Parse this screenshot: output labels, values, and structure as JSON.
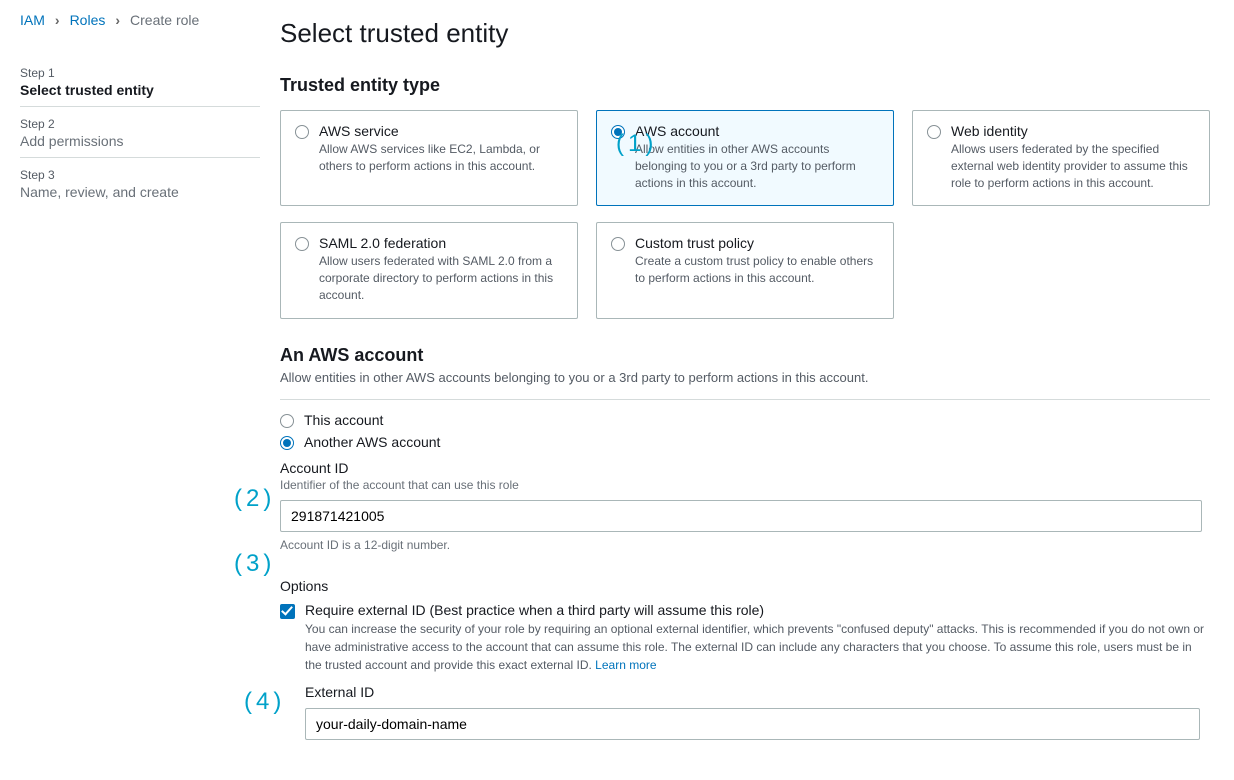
{
  "breadcrumb": {
    "iam": "IAM",
    "roles": "Roles",
    "current": "Create role"
  },
  "steps": [
    {
      "label": "Step 1",
      "title": "Select trusted entity"
    },
    {
      "label": "Step 2",
      "title": "Add permissions"
    },
    {
      "label": "Step 3",
      "title": "Name, review, and create"
    }
  ],
  "page_title": "Select trusted entity",
  "entity_section_title": "Trusted entity type",
  "entities": [
    {
      "title": "AWS service",
      "desc": "Allow AWS services like EC2, Lambda, or others to perform actions in this account."
    },
    {
      "title": "AWS account",
      "desc": "Allow entities in other AWS accounts belonging to you or a 3rd party to perform actions in this account."
    },
    {
      "title": "Web identity",
      "desc": "Allows users federated by the specified external web identity provider to assume this role to perform actions in this account."
    },
    {
      "title": "SAML 2.0 federation",
      "desc": "Allow users federated with SAML 2.0 from a corporate directory to perform actions in this account."
    },
    {
      "title": "Custom trust policy",
      "desc": "Create a custom trust policy to enable others to perform actions in this account."
    }
  ],
  "account_section": {
    "title": "An AWS account",
    "desc": "Allow entities in other AWS accounts belonging to you or a 3rd party to perform actions in this account.",
    "this_account": "This account",
    "another_account": "Another AWS account",
    "account_id_label": "Account ID",
    "account_id_help": "Identifier of the account that can use this role",
    "account_id_value": "291871421005",
    "account_id_note": "Account ID is a 12-digit number."
  },
  "options": {
    "label": "Options",
    "require_external_title": "Require external ID (Best practice when a third party will assume this role)",
    "require_external_desc": "You can increase the security of your role by requiring an optional external identifier, which prevents \"confused deputy\" attacks. This is recommended if you do not own or have administrative access to the account that can assume this role. The external ID can include any characters that you choose. To assume this role, users must be in the trusted account and provide this exact external ID. ",
    "learn_more": "Learn more",
    "external_id_label": "External ID",
    "external_id_value": "your-daily-domain-name"
  },
  "annotations": {
    "a1": "(1)",
    "a2": "(2)",
    "a3": "(3)",
    "a4": "(4)"
  }
}
